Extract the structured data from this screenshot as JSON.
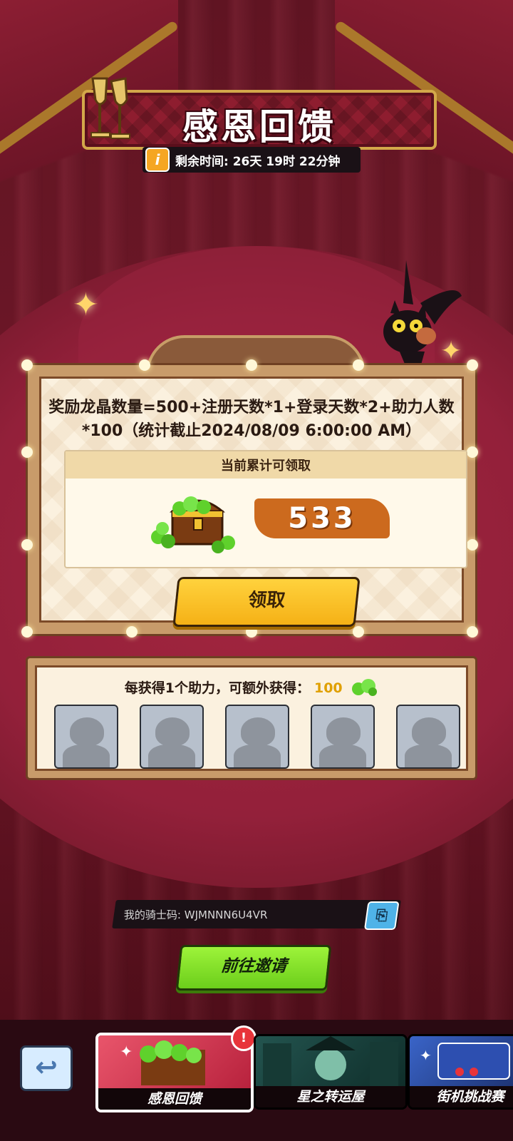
{
  "header": {
    "title": "感恩回馈",
    "timer_text": "剩余时间: 26天 19时 22分钟",
    "info_icon": "i"
  },
  "reward_board": {
    "formula": "奖励龙晶数量=500+注册天数*1+登录天数*2+助力人数*100（统计截止2024/08/09 6:00:00 AM）",
    "accumulated_label": "当前累计可领取",
    "amount": "533",
    "claim_label": "领取"
  },
  "helpers": {
    "bonus_text": "每获得1个助力，可额外获得：",
    "bonus_amount": "100",
    "slots": 5
  },
  "invite": {
    "knight_code": "我的骑士码: WJMNNN6U4VR",
    "copy_icon": "copy-icon",
    "invite_label": "前往邀请"
  },
  "bottom_nav": {
    "back_icon": "back-arrow-icon",
    "tabs": [
      {
        "label": "感恩回馈",
        "active": true,
        "badge": "!"
      },
      {
        "label": "星之转运屋",
        "active": false
      },
      {
        "label": "街机挑战赛",
        "active": false
      }
    ]
  },
  "colors": {
    "curtain": "#7a1a2c",
    "claim_button": "#f5b116",
    "invite_button": "#6cce1b",
    "gem": "#5fd12c"
  }
}
